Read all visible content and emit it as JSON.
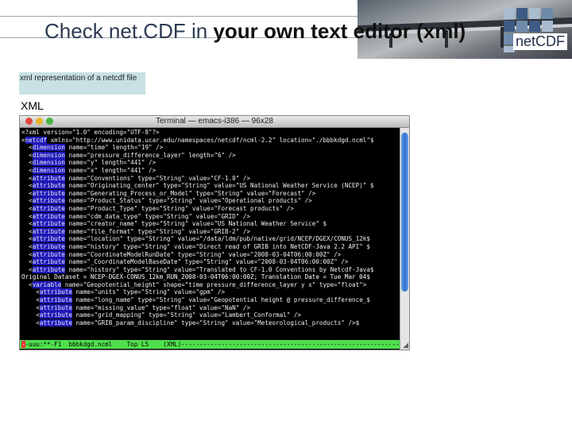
{
  "slide": {
    "title_plain": "Check net.CDF in ",
    "title_bold": "your own text editor (xml)",
    "logo_text": "netCDF",
    "caption": "xml representation of a netcdf file",
    "label": "XML"
  },
  "terminal": {
    "title": "Terminal — emacs-i386 — 96x28",
    "lines": [
      {
        "pre": "<?xml version=\"1.0\" encoding=\"UTF-8\"?>",
        "tag": "",
        "post": ""
      },
      {
        "pre": "<",
        "tag": "netcdf",
        "post": " xmlns=\"http://www.unidata.ucar.edu/namespaces/netcdf/ncml-2.2\" location=\"./bbbkdgd.ncml\"$"
      },
      {
        "pre": "  <",
        "tag": "dimension",
        "post": " name=\"time\" length=\"19\" />"
      },
      {
        "pre": "  <",
        "tag": "dimension",
        "post": " name=\"pressure_difference_layer\" length=\"6\" />"
      },
      {
        "pre": "  <",
        "tag": "dimension",
        "post": " name=\"y\" length=\"441\" />"
      },
      {
        "pre": "  <",
        "tag": "dimension",
        "post": " name=\"x\" length=\"441\" />"
      },
      {
        "pre": "  <",
        "tag": "attribute",
        "post": " name=\"Conventions\" type=\"String\" value=\"CF-1.0\" />"
      },
      {
        "pre": "  <",
        "tag": "attribute",
        "post": " name=\"Originating_center\" type=\"String\" value=\"US National Weather Service (NCEP)\" $"
      },
      {
        "pre": "  <",
        "tag": "attribute",
        "post": " name=\"Generating_Process_or_Model\" type=\"String\" value=\"Forecast\" />"
      },
      {
        "pre": "  <",
        "tag": "attribute",
        "post": " name=\"Product_Status\" type=\"String\" value=\"Operational products\" />"
      },
      {
        "pre": "  <",
        "tag": "attribute",
        "post": " name=\"Product_Type\" type=\"String\" value=\"Forecast products\" />"
      },
      {
        "pre": "  <",
        "tag": "attribute",
        "post": " name=\"cdm_data_type\" type=\"String\" value=\"GRID\" />"
      },
      {
        "pre": "  <",
        "tag": "attribute",
        "post": " name=\"creator_name\" type=\"String\" value=\"US National Weather Service\" $"
      },
      {
        "pre": "  <",
        "tag": "attribute",
        "post": " name=\"file_format\" type=\"String\" value=\"GRIB-2\" />"
      },
      {
        "pre": "  <",
        "tag": "attribute",
        "post": " name=\"location\" type=\"String\" value=\"/data/ldm/pub/native/grid/NCEP/DGEX/CONUS_12k$"
      },
      {
        "pre": "  <",
        "tag": "attribute",
        "post": " name=\"history\" type=\"String\" value=\"Direct read of GRIB into NetCDF-Java 2.2 API\" $"
      },
      {
        "pre": "  <",
        "tag": "attribute",
        "post": " name=\"CoordinateModelRunDate\" type=\"String\" value=\"2008-03-04T06:00:00Z\" />"
      },
      {
        "pre": "  <",
        "tag": "attribute",
        "post": " name=\"_CoordinateModelBaseDate\" type=\"String\" value=\"2008-03-04T06:00:00Z\" />"
      },
      {
        "pre": "  <",
        "tag": "attribute",
        "post": " name=\"history\" type=\"String\" value=\"Translated to CF-1.0 Conventions by Netcdf-Java$"
      },
      {
        "pre": "Original Dataset = NCEP-DGEX-CONUS_12km_RUN_2008-03-04T06:00:00Z; Translation Date = Tue Mar 04$",
        "tag": "",
        "post": "",
        "cls": "cont"
      },
      {
        "pre": "  <",
        "tag": "variable",
        "post": " name=\"Geopotential_height\" shape=\"time pressure_difference_layer y x\" type=\"float\">"
      },
      {
        "pre": "    <",
        "tag": "attribute",
        "post": " name=\"units\" type=\"String\" value=\"gpm\" />"
      },
      {
        "pre": "    <",
        "tag": "attribute",
        "post": " name=\"long_name\" type=\"String\" value=\"Geopotential height @ pressure_difference_$"
      },
      {
        "pre": "    <",
        "tag": "attribute",
        "post": " name=\"missing_value\" type=\"float\" value=\"NaN\" />"
      },
      {
        "pre": "    <",
        "tag": "attribute",
        "post": " name=\"grid_mapping\" type=\"String\" value=\"Lambert_Conformal\" />"
      },
      {
        "pre": "    <",
        "tag": "attribute",
        "post": " name=\"GRIB_param_discipline\" type=\"String\" value=\"Meteorological_products\" />$"
      }
    ],
    "modeline": {
      "cursor": "-",
      "text": "-uuu:**-F1  bbbkdgd.ncml    Top L5    (XML)------------------------------------------------------------"
    }
  }
}
